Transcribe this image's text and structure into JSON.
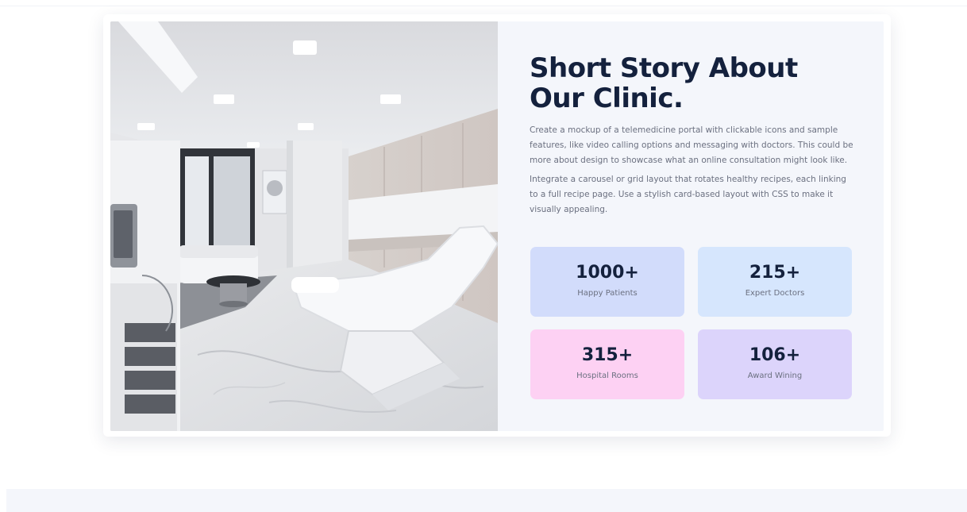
{
  "section": {
    "title_line1": "Short Story About",
    "title_line2": "Our Clinic.",
    "paragraph1": "Create a mockup of a telemedicine portal with clickable icons and sample features, like video calling options and messaging with doctors. This could be more about design to showcase what an online consultation might look like.",
    "paragraph2": "Integrate a carousel or grid layout that rotates healthy recipes, each linking to a full recipe page. Use a stylish card-based layout with CSS to make it visually appealing."
  },
  "stats": [
    {
      "value": "1000+",
      "label": "Happy Patients",
      "color": "#d2dcfb"
    },
    {
      "value": "215+",
      "label": "Expert Doctors",
      "color": "#d6e6fd"
    },
    {
      "value": "315+",
      "label": "Hospital Rooms",
      "color": "#fdd1f3"
    },
    {
      "value": "106+",
      "label": "Award Wining",
      "color": "#dcd4fb"
    }
  ],
  "colors": {
    "heading": "#14213d",
    "body_text": "#6b7080",
    "panel_bg": "#f4f6fb"
  }
}
